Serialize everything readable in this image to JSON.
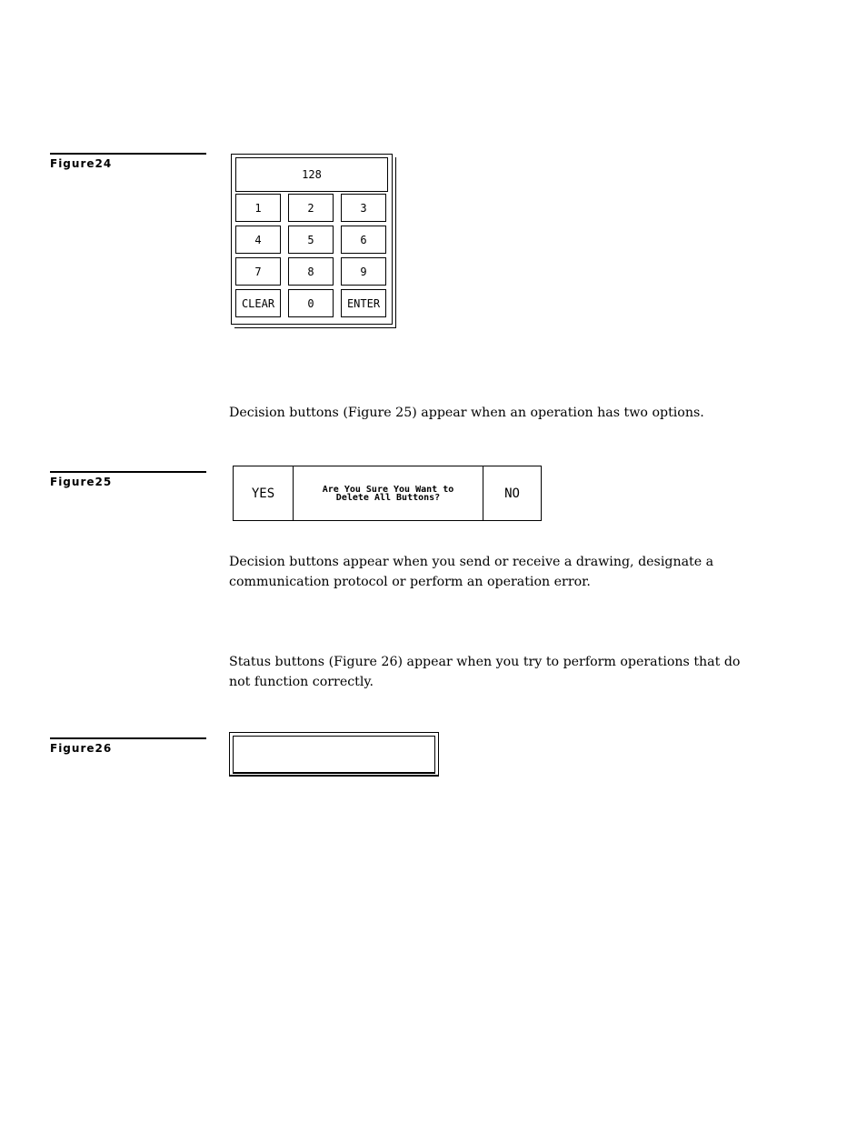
{
  "figures": {
    "fig24": {
      "label": "Figure24"
    },
    "fig25": {
      "label": "Figure25"
    },
    "fig26": {
      "label": "Figure26"
    }
  },
  "keypad": {
    "display_value": "128",
    "keys": [
      "1",
      "2",
      "3",
      "4",
      "5",
      "6",
      "7",
      "8",
      "9",
      "CLEAR",
      "0",
      "ENTER"
    ]
  },
  "decision": {
    "yes_label": "YES",
    "message_line1": "Are You Sure You Want to",
    "message_line2": "Delete All Buttons?",
    "no_label": "NO"
  },
  "paragraphs": {
    "p1": "Decision buttons (Figure 25) appear when an operation has two options.",
    "p2": "Decision buttons appear when you send or receive a drawing, designate a communication protocol or perform an operation error.",
    "p3": "Status buttons (Figure 26) appear when you try to perform operations that do not function correctly."
  }
}
